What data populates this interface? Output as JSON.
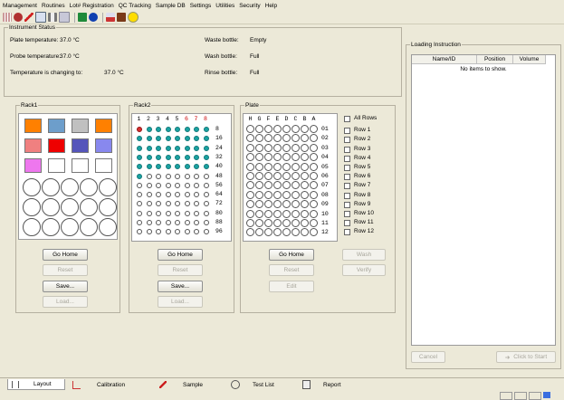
{
  "menu": [
    "Management",
    "Routines",
    "Lot# Registration",
    "QC Tracking",
    "Sample DB",
    "Settings",
    "Utilities",
    "Security",
    "Help"
  ],
  "toolbar_icons": [
    "grid-icon",
    "gear-icon",
    "pen-icon",
    "calendar-icon",
    "tube-icon",
    "list-icon",
    "book-icon",
    "info-icon",
    "chart-icon",
    "cabinet-icon",
    "smile-icon"
  ],
  "instrument_status": {
    "title": "Instrument Status",
    "plate_temp_label": "Plate temperature:",
    "plate_temp": "37.0 °C",
    "probe_temp_label": "Probe temperature:",
    "probe_temp": "37.0 °C",
    "changing_label": "Temperature is changing to:",
    "changing": "37.0 °C",
    "waste_label": "Waste bottle:",
    "waste": "Empty",
    "wash_label": "Wash bottle:",
    "wash": "Full",
    "rinse_label": "Rinse bottle:",
    "rinse": "Full"
  },
  "rack1": {
    "title": "Rack1",
    "colors": [
      "#ff8000",
      "#6d9ecb",
      "#c0c0c0",
      "#ff8000",
      "#f08080",
      "#ee0000",
      "#5555bb",
      "#8888ee",
      "#ee77ee",
      "#ffffff",
      "#ffffff",
      "#ffffff"
    ],
    "buttons": {
      "go_home": "Go Home",
      "reset": "Reset",
      "save": "Save...",
      "load": "Load..."
    }
  },
  "rack2": {
    "title": "Rack2",
    "col_headers": [
      "1",
      "2",
      "3",
      "4",
      "5",
      "6",
      "7",
      "8"
    ],
    "row_numbers": [
      "8",
      "16",
      "24",
      "32",
      "40",
      "48",
      "56",
      "64",
      "72",
      "80",
      "88",
      "96"
    ],
    "filled_rows": 5,
    "buttons": {
      "go_home": "Go Home",
      "reset": "Reset",
      "save": "Save...",
      "load": "Load..."
    }
  },
  "plate": {
    "title": "Plate",
    "col_headers": [
      "H",
      "G",
      "F",
      "E",
      "D",
      "C",
      "B",
      "A"
    ],
    "row_numbers": [
      "01",
      "02",
      "03",
      "04",
      "05",
      "06",
      "07",
      "08",
      "09",
      "10",
      "11",
      "12"
    ],
    "all_rows": "All Rows",
    "rows": [
      "Row 1",
      "Row 2",
      "Row 3",
      "Row 4",
      "Row 5",
      "Row 6",
      "Row 7",
      "Row 8",
      "Row 9",
      "Row 10",
      "Row 11",
      "Row 12"
    ],
    "buttons": {
      "go_home": "Go Home",
      "wash": "Wash",
      "reset": "Reset",
      "verify": "Verify",
      "edit": "Edit"
    }
  },
  "loading": {
    "title": "Loading Instruction",
    "columns": [
      "Name/ID",
      "Position",
      "Volume"
    ],
    "empty": "No items to show.",
    "cancel": "Cancel",
    "click_to_start": "Click to Start"
  },
  "tabs": [
    "Layout",
    "Calibration",
    "Sample",
    "Test List",
    "Report"
  ]
}
